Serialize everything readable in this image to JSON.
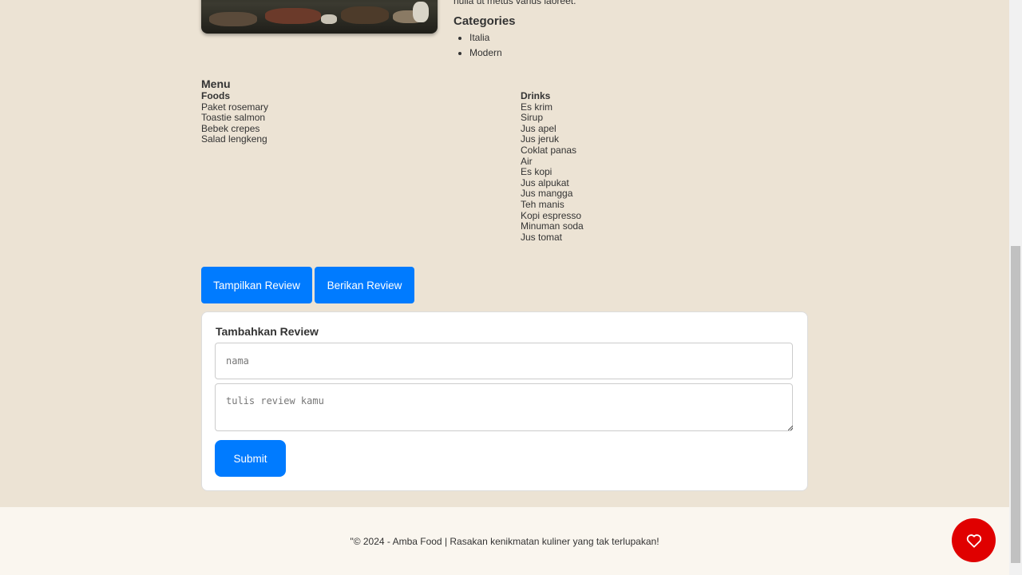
{
  "restaurant": {
    "description_tail": "nulla ut metus varius laoreet.",
    "categories_title": "Categories",
    "categories": [
      "Italia",
      "Modern"
    ]
  },
  "menu": {
    "title": "Menu",
    "foods": {
      "title": "Foods",
      "items": [
        "Paket rosemary",
        "Toastie salmon",
        "Bebek crepes",
        "Salad lengkeng"
      ]
    },
    "drinks": {
      "title": "Drinks",
      "items": [
        "Es krim",
        "Sirup",
        "Jus apel",
        "Jus jeruk",
        "Coklat panas",
        "Air",
        "Es kopi",
        "Jus alpukat",
        "Jus mangga",
        "Teh manis",
        "Kopi espresso",
        "Minuman soda",
        "Jus tomat"
      ]
    }
  },
  "review": {
    "show_button": "Tampilkan Review",
    "give_button": "Berikan Review",
    "form_title": "Tambahkan Review",
    "name_placeholder": "nama",
    "review_placeholder": "tulis review kamu",
    "submit_label": "Submit"
  },
  "footer": {
    "text": "\"© 2024 - Amba Food | Rasakan kenikmatan kuliner yang tak terlupakan!"
  },
  "colors": {
    "page_bg": "#ece3d4",
    "footer_bg": "#faf6ef",
    "primary": "#007bff",
    "fab": "#e00000"
  },
  "icons": {
    "favorite_button": "heart-icon",
    "textarea_resize": "resize-grip-icon"
  }
}
